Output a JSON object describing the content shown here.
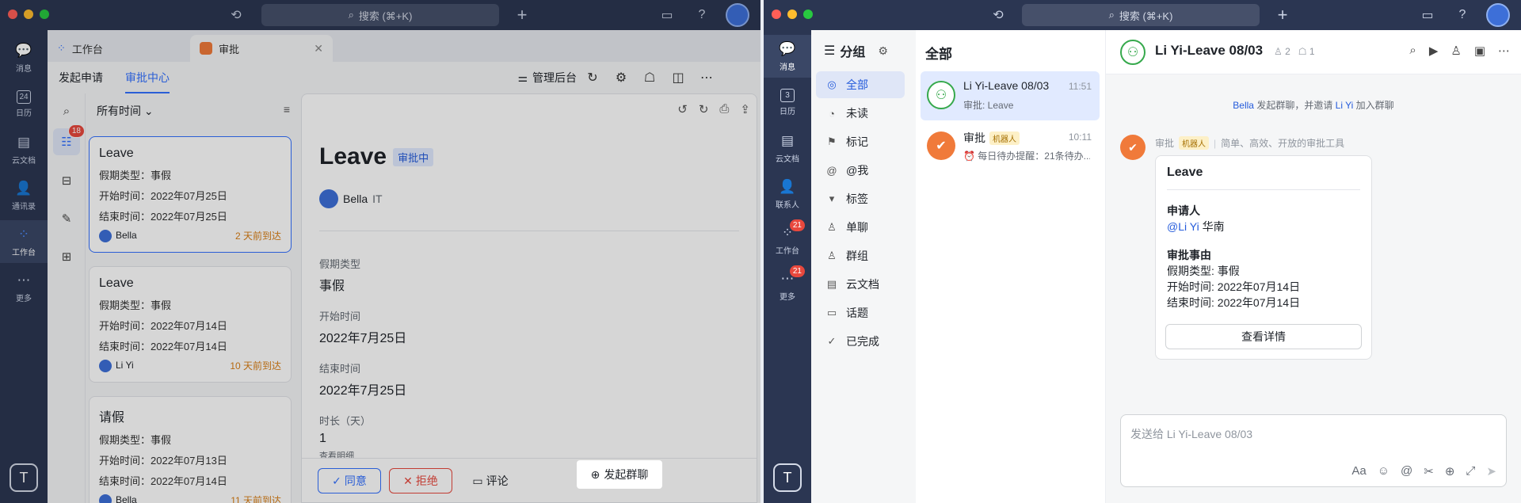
{
  "left_window": {
    "search_placeholder": "搜索 (⌘+K)",
    "rail": [
      {
        "label": "消息",
        "icon": "chat-bubble-icon"
      },
      {
        "label": "日历",
        "icon": "calendar-icon",
        "icon_text": "24"
      },
      {
        "label": "云文档",
        "icon": "document-icon"
      },
      {
        "label": "通讯录",
        "icon": "contacts-icon"
      },
      {
        "label": "工作台",
        "icon": "grid-apps-icon"
      },
      {
        "label": "更多",
        "icon": "more-icon"
      }
    ],
    "t_button": "T",
    "tabs": [
      {
        "label": "工作台"
      },
      {
        "label": "审批"
      }
    ],
    "subtabs": [
      "发起申请",
      "审批中心"
    ],
    "admin_label": "管理后台",
    "filter_label": "所有时间",
    "left_badge": "18",
    "cards": [
      {
        "title": "Leave",
        "type_label": "假期类型：",
        "type_value": "事假",
        "start_label": "开始时间：",
        "start_value": "2022年07月25日",
        "end_label": "结束时间：",
        "end_value": "2022年07月25日",
        "user": "Bella",
        "due": "2 天前到达"
      },
      {
        "title": "Leave",
        "type_label": "假期类型：",
        "type_value": "事假",
        "start_label": "开始时间：",
        "start_value": "2022年07月14日",
        "end_label": "结束时间：",
        "end_value": "2022年07月14日",
        "user": "Li Yi",
        "due": "10 天前到达"
      },
      {
        "title": "请假",
        "type_label": "假期类型：",
        "type_value": "事假",
        "start_label": "开始时间：",
        "start_value": "2022年07月13日",
        "end_label": "结束时间：",
        "end_value": "2022年07月14日",
        "user": "Bella",
        "due": "11 天前到达"
      }
    ],
    "detail": {
      "title": "Leave",
      "status": "审批中",
      "applicant_name": "Bella",
      "applicant_dept": "IT",
      "fields": [
        {
          "label": "假期类型",
          "value": "事假"
        },
        {
          "label": "开始时间",
          "value": "2022年7月25日"
        },
        {
          "label": "结束时间",
          "value": "2022年7月25日"
        },
        {
          "label": "时长（天）",
          "value": "1"
        }
      ],
      "trailing_label": "查看明细"
    },
    "actions": {
      "approve": "同意",
      "reject": "拒绝",
      "comment": "评论",
      "group_chat": "发起群聊",
      "more": "更多"
    }
  },
  "right_window": {
    "search_placeholder": "搜索 (⌘+K)",
    "rail": [
      {
        "label": "消息",
        "icon": "chat-bubble-icon"
      },
      {
        "label": "日历",
        "icon": "calendar-icon",
        "icon_text": "3"
      },
      {
        "label": "云文档",
        "icon": "document-icon"
      },
      {
        "label": "联系人",
        "icon": "contacts-icon"
      },
      {
        "label": "工作台",
        "icon": "grid-apps-icon",
        "badge": "21"
      },
      {
        "label": "更多",
        "icon": "more-icon",
        "badge": "21"
      }
    ],
    "t_button": "T",
    "group_header": "分组",
    "groups": [
      "全部",
      "未读",
      "标记",
      "@我",
      "标签",
      "单聊",
      "群组",
      "云文档",
      "话题",
      "已完成"
    ],
    "list_header": "全部",
    "chats": [
      {
        "name": "Li Yi-Leave 08/03",
        "preview": "审批: Leave",
        "time": "11:51"
      },
      {
        "name": "审批",
        "bot_tag": "机器人",
        "preview": "⏰ 每日待办提醒：21条待办...",
        "time": "10:11"
      }
    ],
    "conversation": {
      "title": "Li Yi-Leave 08/03",
      "member_count": "2",
      "bot_count": "1",
      "system_msg_user": "Bella",
      "system_msg_mid": " 发起群聊，并邀请 ",
      "system_msg_invitee": "Li Yi",
      "system_msg_end": " 加入群聊",
      "sender": "审批",
      "sender_tag": "机器人",
      "sender_desc": "简单、高效、开放的审批工具",
      "card": {
        "title": "Leave",
        "applicant_label": "申请人",
        "applicant_mention": "@Li Yi",
        "applicant_name": "华南",
        "reason_label": "审批事由",
        "lines": [
          "假期类型: 事假",
          "开始时间: 2022年07月14日",
          "结束时间: 2022年07月14日"
        ],
        "button": "查看详情"
      },
      "input_placeholder": "发送给 Li Yi-Leave 08/03"
    }
  },
  "colors": {
    "rail_bg": "#2b3652",
    "accent": "#3370ff",
    "due_orange": "#d97e14",
    "reject_red": "#e8483d",
    "approval_orange": "#f07a3a",
    "group_green": "#36a94c"
  }
}
